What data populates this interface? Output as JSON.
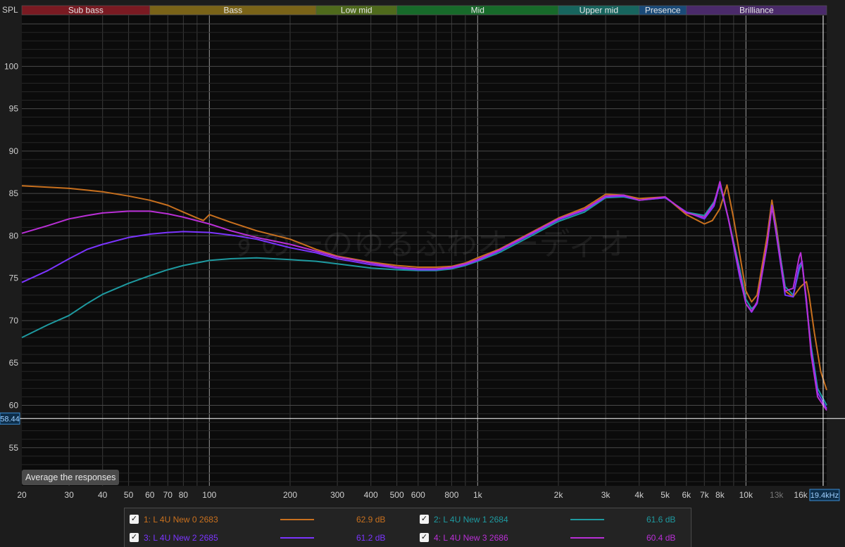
{
  "chart_data": {
    "type": "line",
    "y_axis_label": "SPL",
    "x_scale": "log",
    "xlim": [
      20,
      20000
    ],
    "ylim": [
      50.5,
      106
    ],
    "y_ticks": [
      55,
      60,
      65,
      70,
      75,
      80,
      85,
      90,
      95,
      100
    ],
    "x_ticks": [
      {
        "v": 20,
        "label": "20"
      },
      {
        "v": 30,
        "label": "30"
      },
      {
        "v": 40,
        "label": "40"
      },
      {
        "v": 50,
        "label": "50"
      },
      {
        "v": 60,
        "label": "60"
      },
      {
        "v": 70,
        "label": "70"
      },
      {
        "v": 80,
        "label": "80"
      },
      {
        "v": 100,
        "label": "100"
      },
      {
        "v": 200,
        "label": "200"
      },
      {
        "v": 300,
        "label": "300"
      },
      {
        "v": 400,
        "label": "400"
      },
      {
        "v": 500,
        "label": "500"
      },
      {
        "v": 600,
        "label": "600"
      },
      {
        "v": 800,
        "label": "800"
      },
      {
        "v": 1000,
        "label": "1k"
      },
      {
        "v": 2000,
        "label": "2k"
      },
      {
        "v": 3000,
        "label": "3k"
      },
      {
        "v": 4000,
        "label": "4k"
      },
      {
        "v": 5000,
        "label": "5k"
      },
      {
        "v": 6000,
        "label": "6k"
      },
      {
        "v": 7000,
        "label": "7k"
      },
      {
        "v": 8000,
        "label": "8k"
      },
      {
        "v": 10000,
        "label": "10k"
      },
      {
        "v": 13000,
        "label": "13k",
        "dim": true
      },
      {
        "v": 16000,
        "label": "16k"
      }
    ],
    "bands": [
      {
        "label": "Sub bass",
        "from": 20,
        "to": 60,
        "color": "#7a1a22"
      },
      {
        "label": "Bass",
        "from": 60,
        "to": 250,
        "color": "#7a6318"
      },
      {
        "label": "Low mid",
        "from": 250,
        "to": 500,
        "color": "#4f6a1c"
      },
      {
        "label": "Mid",
        "from": 500,
        "to": 2000,
        "color": "#176a2a"
      },
      {
        "label": "Upper mid",
        "from": 2000,
        "to": 4000,
        "color": "#17655e"
      },
      {
        "label": "Presence",
        "from": 4000,
        "to": 6000,
        "color": "#1a4a78"
      },
      {
        "label": "Brilliance",
        "from": 6000,
        "to": 20000,
        "color": "#4a2a6a"
      }
    ],
    "cursor": {
      "y_label": "58.44",
      "y": 58.44,
      "x_label": "19.4kHz",
      "x": 19400
    },
    "watermark": "すの一のゆるふわオーディオ",
    "series": [
      {
        "name": "1: L 4U New 0 2683",
        "level": "62.9 dB",
        "color": "#c8701e",
        "checked": true,
        "points": [
          [
            20,
            85.9
          ],
          [
            30,
            85.6
          ],
          [
            40,
            85.2
          ],
          [
            50,
            84.7
          ],
          [
            60,
            84.2
          ],
          [
            70,
            83.6
          ],
          [
            80,
            82.8
          ],
          [
            90,
            82.1
          ],
          [
            95,
            81.8
          ],
          [
            100,
            82.5
          ],
          [
            120,
            81.6
          ],
          [
            150,
            80.6
          ],
          [
            200,
            79.6
          ],
          [
            250,
            78.4
          ],
          [
            300,
            77.6
          ],
          [
            400,
            76.9
          ],
          [
            500,
            76.5
          ],
          [
            600,
            76.3
          ],
          [
            700,
            76.3
          ],
          [
            800,
            76.4
          ],
          [
            900,
            76.8
          ],
          [
            1000,
            77.4
          ],
          [
            1200,
            78.4
          ],
          [
            1500,
            80.0
          ],
          [
            2000,
            82.1
          ],
          [
            2500,
            83.3
          ],
          [
            3000,
            84.9
          ],
          [
            3500,
            84.8
          ],
          [
            4000,
            84.4
          ],
          [
            5000,
            84.6
          ],
          [
            6000,
            82.5
          ],
          [
            7000,
            81.4
          ],
          [
            7500,
            81.8
          ],
          [
            8000,
            83.2
          ],
          [
            8500,
            86.0
          ],
          [
            9000,
            82.0
          ],
          [
            10000,
            73.5
          ],
          [
            10500,
            72.2
          ],
          [
            11000,
            73.0
          ],
          [
            12000,
            80.0
          ],
          [
            12500,
            84.2
          ],
          [
            13000,
            81.0
          ],
          [
            14000,
            73.5
          ],
          [
            15000,
            72.8
          ],
          [
            16000,
            74.0
          ],
          [
            16800,
            74.6
          ],
          [
            17200,
            73.0
          ],
          [
            18000,
            68.5
          ],
          [
            19000,
            64.0
          ],
          [
            20000,
            61.8
          ]
        ]
      },
      {
        "name": "2: L 4U New 1 2684",
        "level": "61.6 dB",
        "color": "#1e9aa0",
        "checked": true,
        "points": [
          [
            20,
            68.0
          ],
          [
            25,
            69.5
          ],
          [
            30,
            70.6
          ],
          [
            35,
            72.0
          ],
          [
            40,
            73.1
          ],
          [
            50,
            74.4
          ],
          [
            60,
            75.3
          ],
          [
            70,
            76.0
          ],
          [
            80,
            76.5
          ],
          [
            100,
            77.1
          ],
          [
            120,
            77.3
          ],
          [
            150,
            77.4
          ],
          [
            200,
            77.2
          ],
          [
            250,
            77.0
          ],
          [
            300,
            76.7
          ],
          [
            400,
            76.2
          ],
          [
            500,
            76.0
          ],
          [
            600,
            75.9
          ],
          [
            700,
            75.9
          ],
          [
            800,
            76.1
          ],
          [
            900,
            76.5
          ],
          [
            1000,
            77.0
          ],
          [
            1200,
            78.0
          ],
          [
            1500,
            79.6
          ],
          [
            2000,
            81.7
          ],
          [
            2500,
            82.8
          ],
          [
            3000,
            84.5
          ],
          [
            3500,
            84.6
          ],
          [
            4000,
            84.2
          ],
          [
            5000,
            84.5
          ],
          [
            6000,
            82.8
          ],
          [
            7000,
            82.4
          ],
          [
            7600,
            84.0
          ],
          [
            8000,
            86.0
          ],
          [
            8600,
            82.0
          ],
          [
            9500,
            76.0
          ],
          [
            10000,
            72.5
          ],
          [
            10500,
            71.4
          ],
          [
            11000,
            72.0
          ],
          [
            12000,
            79.0
          ],
          [
            12500,
            83.5
          ],
          [
            13000,
            80.5
          ],
          [
            14000,
            74.0
          ],
          [
            15000,
            73.0
          ],
          [
            15800,
            76.0
          ],
          [
            16200,
            76.8
          ],
          [
            16800,
            72.0
          ],
          [
            17500,
            67.0
          ],
          [
            18500,
            62.0
          ],
          [
            20000,
            60.0
          ]
        ]
      },
      {
        "name": "3: L 4U New 2 2685",
        "level": "61.2 dB",
        "color": "#7b34ff",
        "checked": true,
        "points": [
          [
            20,
            74.5
          ],
          [
            25,
            75.9
          ],
          [
            30,
            77.3
          ],
          [
            35,
            78.4
          ],
          [
            40,
            79.0
          ],
          [
            50,
            79.8
          ],
          [
            60,
            80.2
          ],
          [
            70,
            80.4
          ],
          [
            80,
            80.5
          ],
          [
            100,
            80.4
          ],
          [
            120,
            80.1
          ],
          [
            150,
            79.6
          ],
          [
            200,
            78.6
          ],
          [
            250,
            78.0
          ],
          [
            300,
            77.3
          ],
          [
            400,
            76.6
          ],
          [
            500,
            76.2
          ],
          [
            600,
            76.0
          ],
          [
            700,
            76.0
          ],
          [
            800,
            76.2
          ],
          [
            900,
            76.6
          ],
          [
            1000,
            77.1
          ],
          [
            1200,
            78.2
          ],
          [
            1500,
            79.8
          ],
          [
            2000,
            81.9
          ],
          [
            2500,
            83.0
          ],
          [
            3000,
            84.6
          ],
          [
            3500,
            84.7
          ],
          [
            4000,
            84.2
          ],
          [
            5000,
            84.5
          ],
          [
            6000,
            82.8
          ],
          [
            7000,
            82.0
          ],
          [
            7600,
            83.5
          ],
          [
            8000,
            86.2
          ],
          [
            8600,
            82.0
          ],
          [
            9500,
            75.0
          ],
          [
            10000,
            72.0
          ],
          [
            10500,
            71.0
          ],
          [
            11000,
            72.0
          ],
          [
            12000,
            79.0
          ],
          [
            12500,
            83.6
          ],
          [
            13000,
            80.0
          ],
          [
            14000,
            73.0
          ],
          [
            15000,
            72.8
          ],
          [
            15800,
            76.5
          ],
          [
            16200,
            77.0
          ],
          [
            16800,
            72.0
          ],
          [
            17500,
            66.5
          ],
          [
            18500,
            61.5
          ],
          [
            20000,
            59.6
          ]
        ]
      },
      {
        "name": "4: L 4U New 3 2686",
        "level": "60.4 dB",
        "color": "#b92fd6",
        "checked": true,
        "points": [
          [
            20,
            80.3
          ],
          [
            25,
            81.2
          ],
          [
            30,
            82.0
          ],
          [
            35,
            82.4
          ],
          [
            40,
            82.7
          ],
          [
            50,
            82.9
          ],
          [
            60,
            82.9
          ],
          [
            70,
            82.6
          ],
          [
            80,
            82.2
          ],
          [
            100,
            81.4
          ],
          [
            120,
            80.6
          ],
          [
            150,
            79.8
          ],
          [
            200,
            79.0
          ],
          [
            250,
            78.2
          ],
          [
            300,
            77.5
          ],
          [
            400,
            76.8
          ],
          [
            500,
            76.3
          ],
          [
            600,
            76.1
          ],
          [
            700,
            76.1
          ],
          [
            800,
            76.3
          ],
          [
            900,
            76.7
          ],
          [
            1000,
            77.2
          ],
          [
            1200,
            78.3
          ],
          [
            1500,
            79.9
          ],
          [
            2000,
            82.0
          ],
          [
            2500,
            83.1
          ],
          [
            3000,
            84.7
          ],
          [
            3500,
            84.8
          ],
          [
            4000,
            84.2
          ],
          [
            5000,
            84.6
          ],
          [
            6000,
            82.7
          ],
          [
            7000,
            82.2
          ],
          [
            7600,
            83.8
          ],
          [
            8000,
            86.4
          ],
          [
            8600,
            82.0
          ],
          [
            9500,
            75.5
          ],
          [
            10000,
            72.0
          ],
          [
            10500,
            71.1
          ],
          [
            11000,
            72.2
          ],
          [
            12000,
            79.2
          ],
          [
            12500,
            83.4
          ],
          [
            13000,
            80.2
          ],
          [
            14000,
            73.5
          ],
          [
            15000,
            73.8
          ],
          [
            15800,
            77.5
          ],
          [
            16000,
            78.0
          ],
          [
            16800,
            72.5
          ],
          [
            17500,
            66.0
          ],
          [
            18500,
            61.0
          ],
          [
            20000,
            59.4
          ]
        ]
      }
    ]
  },
  "ui": {
    "average_button": "Average the responses",
    "check_glyph": "✓"
  }
}
